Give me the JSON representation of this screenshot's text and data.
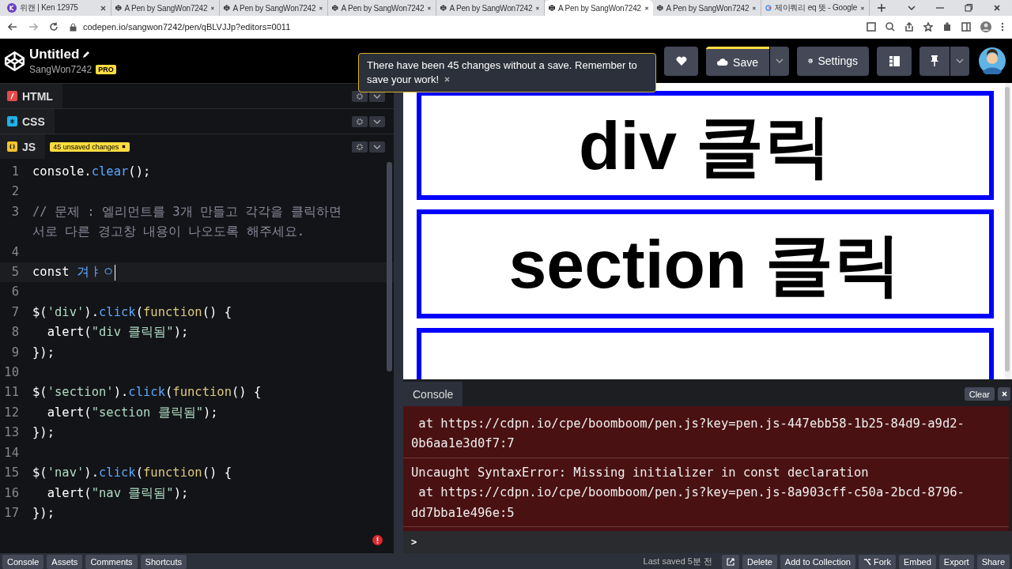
{
  "browser": {
    "tabs": [
      {
        "title": "위캔 | Ken 12975",
        "kind": "k",
        "selected": false
      },
      {
        "title": "A Pen by SangWon7242",
        "kind": "codepen",
        "selected": false
      },
      {
        "title": "A Pen by SangWon7242",
        "kind": "codepen",
        "selected": false
      },
      {
        "title": "A Pen by SangWon7242",
        "kind": "codepen",
        "selected": false
      },
      {
        "title": "A Pen by SangWon7242",
        "kind": "codepen",
        "selected": false
      },
      {
        "title": "A Pen by SangWon7242",
        "kind": "codepen",
        "selected": true
      },
      {
        "title": "A Pen by SangWon7242",
        "kind": "codepen",
        "selected": false
      },
      {
        "title": "제이쿼리 eq 뜻 - Google",
        "kind": "google",
        "selected": false
      }
    ],
    "url": "codepen.io/sangwon7242/pen/qBLVJJp?editors=0011"
  },
  "header": {
    "title": "Untitled",
    "user": "SangWon7242",
    "badge": "PRO",
    "notice": "There have been 45 changes without a save. Remember to save your work!",
    "save_label": "Save",
    "settings_label": "Settings"
  },
  "editors": [
    {
      "label": "HTML",
      "kind": "html"
    },
    {
      "label": "CSS",
      "kind": "css"
    },
    {
      "label": "JS",
      "kind": "js",
      "badge": "45 unsaved changes"
    }
  ],
  "code": [
    {
      "num": "1",
      "active": false,
      "tokens": [
        {
          "t": "console.",
          "kind": "plain"
        },
        {
          "t": "clear",
          "kind": "method"
        },
        {
          "t": "();",
          "kind": "plain"
        }
      ]
    },
    {
      "num": "2",
      "active": false
    },
    {
      "num": "3",
      "active": false,
      "tokens": [
        {
          "t": "// 문제 : 엘리먼트를 3개 만들고 각각을 클릭하면 서로 다른 경고창 내용이 나오도록 해주세요.",
          "kind": "comment"
        }
      ]
    },
    {
      "num": "4",
      "active": false
    },
    {
      "num": "5",
      "active": true,
      "tokens": [
        {
          "t": "const ",
          "kind": "plain"
        },
        {
          "t": "겨ㅑㅇ",
          "kind": "var"
        }
      ]
    },
    {
      "num": "6",
      "active": false
    },
    {
      "num": "7",
      "active": false,
      "tokens": [
        {
          "t": "$(",
          "kind": "plain"
        },
        {
          "t": "'div'",
          "kind": "str"
        },
        {
          "t": ").",
          "kind": "plain"
        },
        {
          "t": "click",
          "kind": "method"
        },
        {
          "t": "(",
          "kind": "plain"
        },
        {
          "t": "function",
          "kind": "kw"
        },
        {
          "t": "() {",
          "kind": "plain"
        }
      ]
    },
    {
      "num": "8",
      "active": false,
      "tokens": [
        {
          "t": "  alert(",
          "kind": "plain"
        },
        {
          "t": "\"div 클릭됨\"",
          "kind": "str"
        },
        {
          "t": ");",
          "kind": "plain"
        }
      ]
    },
    {
      "num": "9",
      "active": false,
      "tokens": [
        {
          "t": "});",
          "kind": "plain"
        }
      ]
    },
    {
      "num": "10",
      "active": false
    },
    {
      "num": "11",
      "active": false,
      "tokens": [
        {
          "t": "$(",
          "kind": "plain"
        },
        {
          "t": "'section'",
          "kind": "str"
        },
        {
          "t": ").",
          "kind": "plain"
        },
        {
          "t": "click",
          "kind": "method"
        },
        {
          "t": "(",
          "kind": "plain"
        },
        {
          "t": "function",
          "kind": "kw"
        },
        {
          "t": "() {",
          "kind": "plain"
        }
      ]
    },
    {
      "num": "12",
      "active": false,
      "tokens": [
        {
          "t": "  alert(",
          "kind": "plain"
        },
        {
          "t": "\"section 클릭됨\"",
          "kind": "str"
        },
        {
          "t": ");",
          "kind": "plain"
        }
      ]
    },
    {
      "num": "13",
      "active": false,
      "tokens": [
        {
          "t": "});",
          "kind": "plain"
        }
      ]
    },
    {
      "num": "14",
      "active": false
    },
    {
      "num": "15",
      "active": false,
      "tokens": [
        {
          "t": "$(",
          "kind": "plain"
        },
        {
          "t": "'nav'",
          "kind": "str"
        },
        {
          "t": ").",
          "kind": "plain"
        },
        {
          "t": "click",
          "kind": "method"
        },
        {
          "t": "(",
          "kind": "plain"
        },
        {
          "t": "function",
          "kind": "kw"
        },
        {
          "t": "() {",
          "kind": "plain"
        }
      ]
    },
    {
      "num": "16",
      "active": false,
      "tokens": [
        {
          "t": "  alert(",
          "kind": "plain"
        },
        {
          "t": "\"nav 클릭됨\"",
          "kind": "str"
        },
        {
          "t": ");",
          "kind": "plain"
        }
      ]
    },
    {
      "num": "17",
      "active": false,
      "tokens": [
        {
          "t": "});",
          "kind": "plain"
        }
      ]
    }
  ],
  "preview": {
    "boxes": [
      {
        "kind": "labeled",
        "label": "div 클릭"
      },
      {
        "kind": "labeled",
        "label": "section 클릭"
      },
      {
        "kind": "cut_off"
      }
    ]
  },
  "console": {
    "title": "Console",
    "clear_label": "Clear",
    "messages": [
      {
        "location": " at https://cdpn.io/cpe/boomboom/pen.js?key=pen.js-447ebb58-1b25-84d9-a9d2-0b6aa1e3d0f7:7"
      },
      {
        "error": "Uncaught SyntaxError: Missing initializer in const declaration",
        "location": " at https://cdpn.io/cpe/boomboom/pen.js?key=pen.js-8a903cff-c50a-2bcd-8796-dd7bba1e496e:5"
      }
    ],
    "prompt": ">"
  },
  "footer": {
    "left_buttons": [
      "Console",
      "Assets",
      "Comments",
      "Shortcuts"
    ],
    "last_saved": "Last saved 5분 전",
    "right_buttons": [
      {
        "label": "Delete",
        "kind": "plain"
      },
      {
        "label": "Add to Collection",
        "kind": "plain"
      },
      {
        "label": "Fork",
        "kind": "fork"
      },
      {
        "label": "Embed",
        "kind": "plain"
      },
      {
        "label": "Export",
        "kind": "plain"
      },
      {
        "label": "Share",
        "kind": "plain"
      }
    ]
  }
}
